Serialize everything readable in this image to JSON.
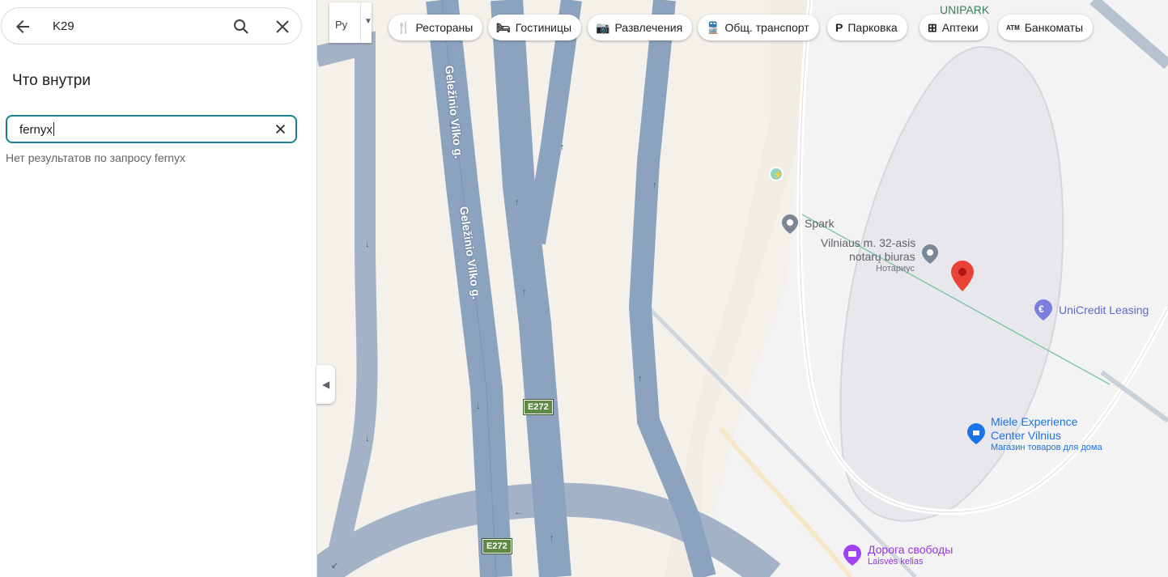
{
  "search": {
    "query": "K29"
  },
  "inside": {
    "heading": "Что внутри",
    "input_value": "fernyx",
    "no_results": "Нет результатов по запросу fernyx"
  },
  "map": {
    "lang_label": "Ру",
    "chips": [
      {
        "icon": "restaurant-icon",
        "glyph": "🍴",
        "label": "Рестораны"
      },
      {
        "icon": "hotel-icon",
        "glyph": "🛏",
        "label": "Гостиницы"
      },
      {
        "icon": "camera-icon",
        "glyph": "📷",
        "label": "Развлечения"
      },
      {
        "icon": "transit-icon",
        "glyph": "🚆",
        "label": "Общ. транспорт"
      },
      {
        "icon": "parking-icon",
        "glyph": "P",
        "label": "Парковка"
      },
      {
        "icon": "pharmacy-icon",
        "glyph": "⊞",
        "label": "Аптеки"
      },
      {
        "icon": "atm-icon",
        "glyph": "ATM",
        "label": "Банкоматы"
      }
    ],
    "roads": {
      "street_1": "Geležinio Vilko g.",
      "street_2": "Geležinio Vilko g.",
      "route_1": "E272",
      "route_2": "E272"
    },
    "pois": {
      "unipark": "UNIPARK",
      "spark": "Spark",
      "notary_1": "Vilniaus m. 32-asis",
      "notary_2": "notarų biuras",
      "notary_sub": "Нотариус",
      "unicredit": "UniCredit Leasing",
      "miele_1": "Miele Experience",
      "miele_2": "Center Vilnius",
      "miele_sub": "Магазин товаров для дома",
      "freedom": "Дорога свободы",
      "freedom_sub": "Laisvės kelias"
    },
    "colors": {
      "road": "#8ca3bf",
      "poi_blue": "#1a73e8",
      "poi_purple": "#9334e6",
      "marker": "#ea4335"
    }
  }
}
